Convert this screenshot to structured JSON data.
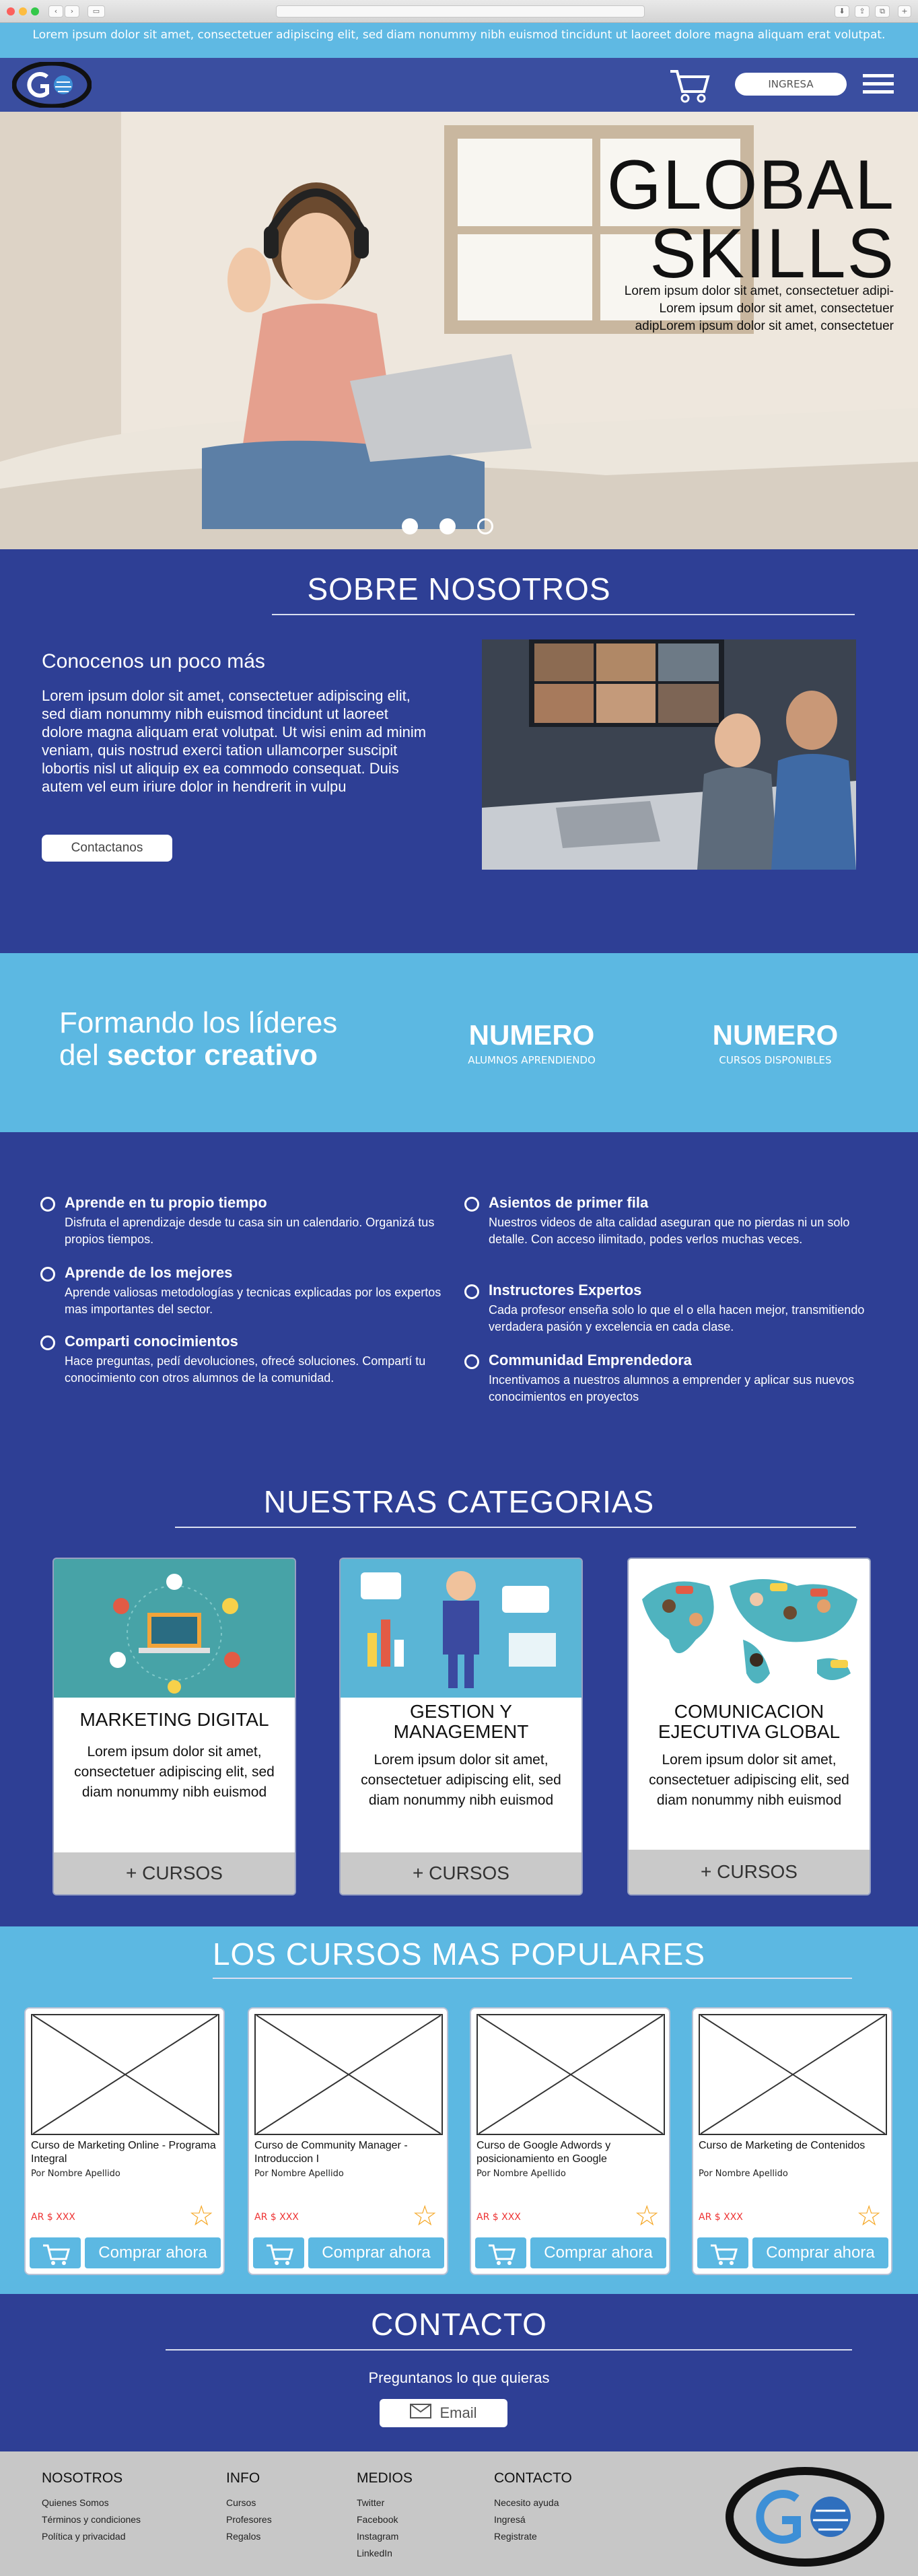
{
  "top_banner": "Lorem ipsum dolor sit amet, consectetuer adipiscing elit, sed diam nonummy nibh euismod tincidunt ut laoreet dolore magna aliquam erat volutpat.",
  "nav": {
    "login_label": "INGRESA",
    "logo_text": "GO"
  },
  "hero": {
    "title_line1": "GLOBAL",
    "title_line2": "SKILLS",
    "subtitle_lines": [
      "Lorem ipsum dolor sit amet, consectetuer adipi-",
      "Lorem ipsum dolor sit amet, consectetuer",
      "adipLorem ipsum dolor sit amet, consectetuer"
    ]
  },
  "about": {
    "title": "SOBRE NOSOTROS",
    "heading": "Conocenos un poco más",
    "body": "Lorem ipsum dolor sit amet, consectetuer adipiscing elit, sed diam nonummy nibh euismod tincidunt ut laoreet dolore magna aliquam erat volutpat. Ut wisi enim ad minim veniam, quis nostrud exerci tation ullamcorper suscipit lobortis nisl ut aliquip ex ea commodo consequat. Duis autem vel eum iriure dolor in hendrerit in vulpu",
    "button": "Contactanos"
  },
  "stats": {
    "tagline_line1": "Formando los líderes",
    "tagline_line2_plain": "del ",
    "tagline_line2_bold": "sector creativo",
    "items": [
      {
        "number": "NUMERO",
        "label": "ALUMNOS APRENDIENDO"
      },
      {
        "number": "NUMERO",
        "label": "CURSOS DISPONIBLES"
      }
    ]
  },
  "features": [
    {
      "title": "Aprende en tu propio tiempo",
      "text": "Disfruta el aprendizaje desde tu casa sin un calendario. Organizá tus propios tiempos."
    },
    {
      "title": "Aprende de los mejores",
      "text": "Aprende valiosas metodologías y tecnicas explicadas por los expertos mas importantes del sector."
    },
    {
      "title": "Comparti conocimientos",
      "text": "Hace preguntas, pedí devoluciones, ofrecé soluciones. Compartí tu conocimiento con otros alumnos de la comunidad."
    },
    {
      "title": "Asientos de primer fila",
      "text": "Nuestros videos de alta calidad aseguran que no pierdas ni un solo detalle. Con acceso ilimitado, podes verlos muchas veces."
    },
    {
      "title": "Instructores Expertos",
      "text": "Cada profesor enseña solo lo que el o ella hacen mejor, transmitiendo verdadera pasión y excelencia en cada clase."
    },
    {
      "title": "Communidad Emprendedora",
      "text": "Incentivamos a nuestros alumnos a emprender y aplicar sus nuevos conocimientos en proyectos"
    }
  ],
  "categories": {
    "title": "NUESTRAS CATEGORIAS",
    "items": [
      {
        "name": "MARKETING DIGITAL",
        "text": "Lorem ipsum dolor sit amet, consectetuer adipiscing elit, sed diam nonummy nibh euismod",
        "more": "+ CURSOS"
      },
      {
        "name": "GESTION Y MANAGEMENT",
        "text": "Lorem ipsum dolor sit amet, consectetuer adipiscing elit, sed diam nonummy nibh euismod",
        "more": "+ CURSOS"
      },
      {
        "name": "COMUNICACION EJECUTIVA GLOBAL",
        "text": "Lorem ipsum dolor sit amet, consectetuer adipiscing elit, sed diam nonummy nibh euismod",
        "more": "+ CURSOS"
      }
    ]
  },
  "popular": {
    "title": "LOS CURSOS MAS POPULARES",
    "courses": [
      {
        "title": "Curso de Marketing Online - Programa Integral",
        "author": "Por Nombre Apellido",
        "price": "AR $ XXX",
        "buy": "Comprar ahora"
      },
      {
        "title": "Curso de Community Manager - Introduccion I",
        "author": "Por Nombre Apellido",
        "price": "AR $ XXX",
        "buy": "Comprar ahora"
      },
      {
        "title": "Curso de Google Adwords y posicionamiento en Google",
        "author": "Por Nombre Apellido",
        "price": "AR $ XXX",
        "buy": "Comprar ahora"
      },
      {
        "title": "Curso de Marketing de Contenidos",
        "author": "Por Nombre Apellido",
        "price": "AR $ XXX",
        "buy": "Comprar ahora"
      }
    ]
  },
  "contact": {
    "title": "CONTACTO",
    "subtitle": "Preguntanos lo que quieras",
    "email_label": "Email"
  },
  "footer": {
    "columns": [
      {
        "title": "NOSOTROS",
        "links": [
          "Quienes Somos",
          "Términos y condiciones",
          "Política y privacidad"
        ]
      },
      {
        "title": "INFO",
        "links": [
          "Cursos",
          "Profesores",
          "Regalos"
        ]
      },
      {
        "title": "MEDIOS",
        "links": [
          "Twitter",
          "Facebook",
          "Instagram",
          "LinkedIn"
        ]
      },
      {
        "title": "CONTACTO",
        "links": [
          "Necesito ayuda",
          "Ingresá",
          "Registrate"
        ]
      }
    ],
    "logo_text": "GO"
  },
  "colors": {
    "navy": "#2e3f95",
    "sky": "#5cb8e2",
    "footer": "#c7c7c7",
    "star": "#f5a623",
    "price": "#e33333"
  }
}
